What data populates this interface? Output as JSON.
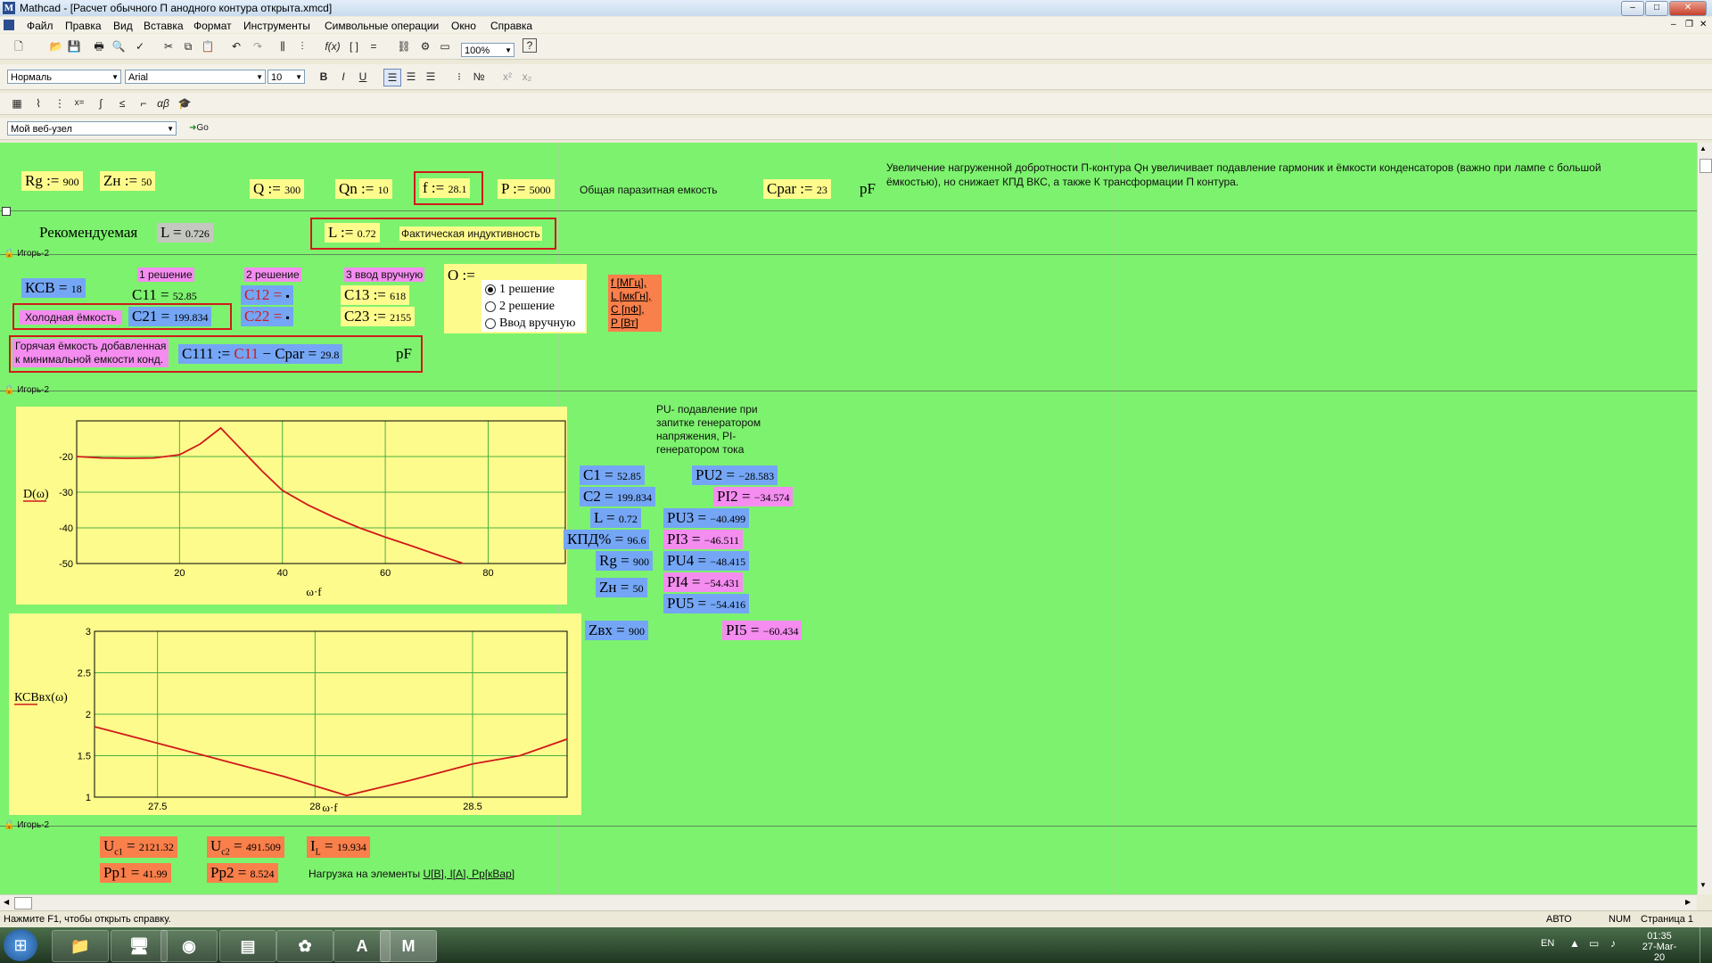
{
  "window": {
    "title": "Mathcad - [Расчет обычного П анодного контура открыта.xmcd]",
    "min": "–",
    "max": "□",
    "close": "✕"
  },
  "menu": [
    "Файл",
    "Правка",
    "Вид",
    "Вставка",
    "Формат",
    "Инструменты",
    "Символьные операции",
    "Окно",
    "Справка"
  ],
  "toolbar": {
    "zoom": "100%",
    "style": "Нормаль",
    "font": "Arial",
    "size": "10",
    "bold": "B",
    "italic": "I",
    "underline": "U",
    "web_address": "Мой веб-узел",
    "go": "Go"
  },
  "ws": {
    "row1": {
      "rg_name": "Rg :=",
      "rg_val": "900",
      "zn_name": "Zн :=",
      "zn_val": "50",
      "q_name": "Q :=",
      "q_val": "300",
      "qn_name": "Qn :=",
      "qn_val": "10",
      "f_name": "f :=",
      "f_val": "28.1",
      "p_name": "P :=",
      "p_val": "5000",
      "cpar_label": "Общая паразитная емкость",
      "cpar_name": "Cpar :=",
      "cpar_val": "23",
      "pf": "pF",
      "note": "Увеличение нагруженной добротности П-контура Qн увеличивает подавление гармоник и ёмкости конденсаторов (важно при лампе с большой ёмкостью), но снижает КПД ВКС, а также К трансформации П контура."
    },
    "row2": {
      "rec_label": "Рекомендуемая",
      "l_rec_name": "L =",
      "l_rec_val": "0.726",
      "l_name": "L :=",
      "l_val": "0.72",
      "l_label": "Фактическая индуктивность"
    },
    "region_tag": "Игорь-2",
    "row3": {
      "ksv_name": "КСВ =",
      "ksv_val": "18",
      "sol1": "1 решение",
      "sol2": "2 решение",
      "sol3": "3 ввод вручную",
      "c11_name": "C11 =",
      "c11_val": "52.85",
      "c21_name": "C21 =",
      "c21_val": "199.834",
      "c12_name": "C12 =",
      "c12_val": "▪",
      "c22_name": "C22 =",
      "c22_val": "▪",
      "c13_name": "C13 :=",
      "c13_val": "618",
      "c23_name": "C23 :=",
      "c23_val": "2155",
      "cold_label": "Холодная ёмкость",
      "o_name": "O :=",
      "radio": [
        "1 решение",
        "2 решение",
        "Ввод вручную"
      ],
      "units": [
        "f [МГц],",
        "L [мкГн],",
        "C [пФ],",
        "P [Вт]"
      ],
      "hot_label1": "Горячая ёмкость добавленная",
      "hot_label2": "к минимальной емкости конд.",
      "c111_name": "C111 :=",
      "c111_c11": "C11",
      "c111_rest": "− Cpar =",
      "c111_val": "29.8",
      "c111_pf": "pF"
    },
    "chart1": {
      "ylabel": "D(ω)",
      "xlabel": "ω·f"
    },
    "chart2": {
      "ylabel": "КСВвх(ω)",
      "xlabel": "ω·f"
    },
    "side": {
      "pu_note": "PU- подавление при запитке генератором напряжения, PI- генератором тока",
      "c1_name": "C1 =",
      "c1_val": "52.85",
      "c2_name": "C2 =",
      "c2_val": "199.834",
      "l_name": "L =",
      "l_val": "0.72",
      "kpd_name": "КПД% =",
      "kpd_val": "96.6",
      "rg_name": "Rg =",
      "rg_val": "900",
      "zn_name": "Zн =",
      "zn_val": "50",
      "zvx_name": "Zвх =",
      "zvx_val": "900",
      "pu2_name": "PU2 =",
      "pu2_val": "−28.583",
      "pi2_name": "PI2 =",
      "pi2_val": "−34.574",
      "pu3_name": "PU3 =",
      "pu3_val": "−40.499",
      "pi3_name": "PI3 =",
      "pi3_val": "−46.511",
      "pu4_name": "PU4 =",
      "pu4_val": "−48.415",
      "pi4_name": "PI4 =",
      "pi4_val": "−54.431",
      "pu5_name": "PU5 =",
      "pu5_val": "−54.416",
      "pi5_name": "PI5 =",
      "pi5_val": "−60.434"
    },
    "bottom": {
      "uc1_name": "U",
      "uc1_sub": "c1",
      "uc1_val": "2121.32",
      "uc2_name": "U",
      "uc2_sub": "c2",
      "uc2_val": "491.509",
      "il_name": "I",
      "il_sub": "L",
      "il_val": "19.934",
      "pp1_name": "Pp1 =",
      "pp1_val": "41.99",
      "pp2_name": "Pp2 =",
      "pp2_val": "8.524",
      "note": "Нагрузка на элементы ",
      "note_link": "U[В], I[А], Pp[кВар]"
    }
  },
  "status": {
    "help": "Нажмите F1, чтобы открыть справку.",
    "auto": "АВТО",
    "num": "NUM",
    "page": "Страница 1"
  },
  "taskbar": {
    "lang": "EN",
    "time": "01:35",
    "date": "27-Mar-20"
  },
  "chart_data": [
    {
      "type": "line",
      "ylabel": "D(ω)",
      "xlabel": "ω·f",
      "xlim": [
        0,
        95
      ],
      "ylim": [
        -50,
        -10
      ],
      "xticks": [
        20,
        40,
        60,
        80
      ],
      "yticks": [
        -20,
        -30,
        -40,
        -50
      ],
      "grid": true,
      "series": [
        {
          "color": "#d01a1a",
          "x": [
            0,
            5,
            10,
            15,
            20,
            24,
            28,
            32,
            36,
            40,
            45,
            50,
            55,
            60,
            65,
            70,
            75
          ],
          "y": [
            -20,
            -20.4,
            -20.5,
            -20.4,
            -19.5,
            -16.5,
            -12,
            -18,
            -24,
            -29.5,
            -33.6,
            -37,
            -40,
            -42.6,
            -45,
            -47.5,
            -49.9
          ]
        }
      ]
    },
    {
      "type": "line",
      "ylabel": "КСВвх(ω)",
      "xlabel": "ω·f",
      "xlim": [
        27.3,
        28.8
      ],
      "ylim": [
        1,
        3
      ],
      "xticks": [
        27.5,
        28,
        28.5
      ],
      "yticks": [
        1,
        1.5,
        2,
        2.5,
        3
      ],
      "grid": true,
      "series": [
        {
          "color": "#d01a1a",
          "x": [
            27.3,
            27.5,
            27.7,
            27.9,
            28.1,
            28.3,
            28.5,
            28.65,
            28.8
          ],
          "y": [
            1.85,
            1.65,
            1.45,
            1.25,
            1.02,
            1.2,
            1.4,
            1.5,
            1.7
          ]
        }
      ]
    }
  ]
}
